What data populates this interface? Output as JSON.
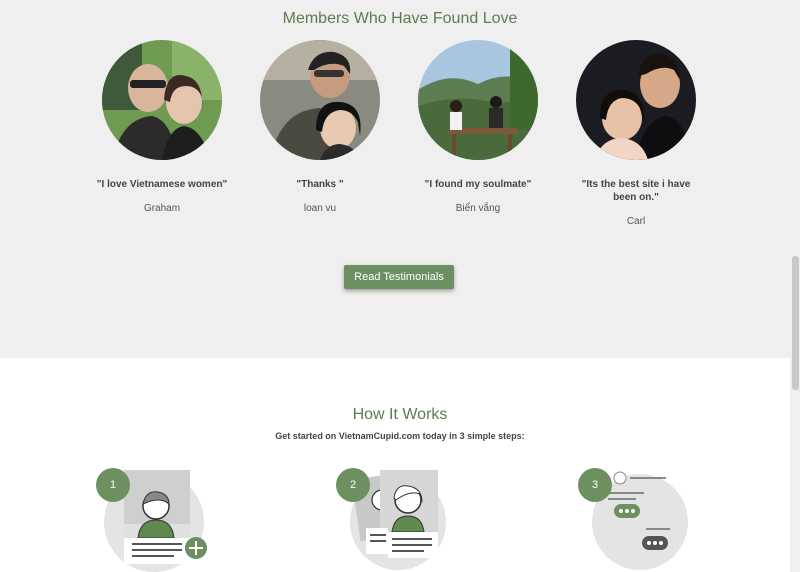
{
  "found_love": {
    "title": "Members Who Have Found Love",
    "members": [
      {
        "quote": "\"I love Vietnamese women\"",
        "name": "Graham"
      },
      {
        "quote": "\"Thanks \"",
        "name": "loan vu"
      },
      {
        "quote": "\"I found my soulmate\"",
        "name": "Biển vắng"
      },
      {
        "quote": "\"Its the best site i have been on.\"",
        "name": "Carl"
      }
    ],
    "button_label": "Read Testimonials"
  },
  "how_it_works": {
    "title": "How It Works",
    "subtitle": "Get started on VietnamCupid.com today in 3 simple steps:",
    "steps": [
      {
        "number": "1",
        "icon": "create-profile-icon"
      },
      {
        "number": "2",
        "icon": "browse-profiles-icon"
      },
      {
        "number": "3",
        "icon": "chat-icon"
      }
    ]
  },
  "colors": {
    "accent": "#6c9060",
    "title": "#5c7d4e",
    "section_bg": "#efefef"
  }
}
